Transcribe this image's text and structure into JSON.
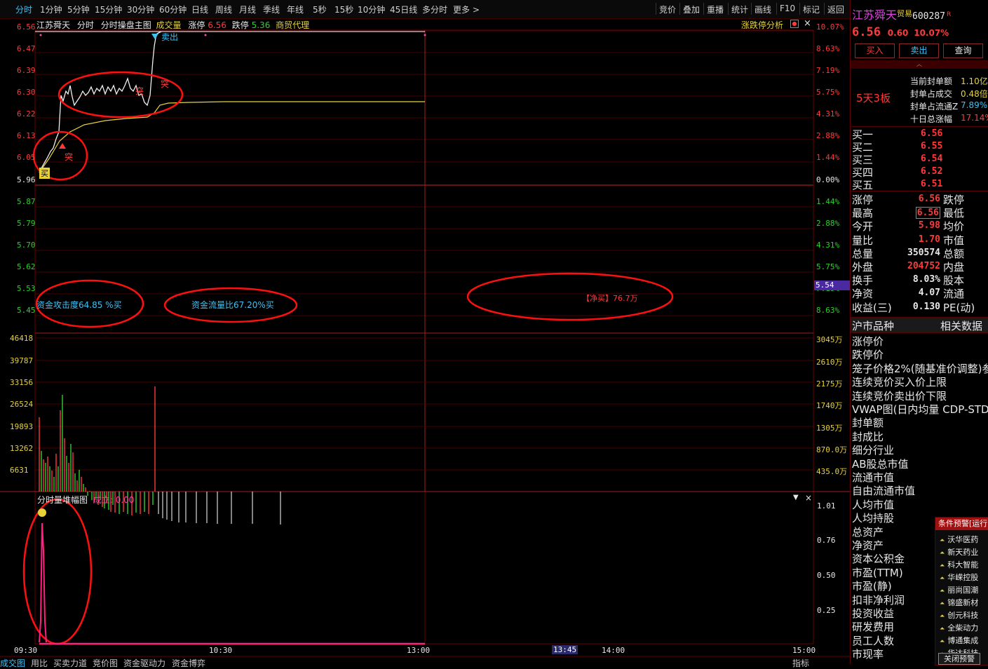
{
  "toolbar": {
    "periods": [
      "分时",
      "1分钟",
      "5分钟",
      "15分钟",
      "30分钟",
      "60分钟",
      "日线",
      "周线",
      "月线",
      "季线",
      "年线",
      "5秒",
      "15秒",
      "10分钟",
      "45日线",
      "多分时",
      "更多 >"
    ],
    "right": [
      "竞价",
      "叠加",
      "重播",
      "统计",
      "画线",
      "F10",
      "标记",
      "返回"
    ]
  },
  "header": {
    "name": "江苏舜天",
    "mode": "分时",
    "main_chart": "分时操盘主图",
    "volume_label": "成交量",
    "limit_up_label": "涨停",
    "limit_up_value": "6.56",
    "limit_down_label": "跌停",
    "limit_down_value": "5.36",
    "industry": "商贸代理",
    "analysis_btn": "涨跌停分析"
  },
  "price_axis": {
    "left": [
      "6.56",
      "6.47",
      "6.39",
      "6.30",
      "6.22",
      "6.13",
      "6.05",
      "5.96",
      "5.87",
      "5.79",
      "5.70",
      "5.62",
      "5.53",
      "5.45"
    ],
    "right": [
      "10.07%",
      "8.63%",
      "7.19%",
      "5.75%",
      "4.31%",
      "2.88%",
      "1.44%",
      "0.00%",
      "1.44%",
      "2.88%",
      "4.31%",
      "5.75%",
      "7.19%",
      "8.63%"
    ],
    "current_tag": "5.54"
  },
  "volume_axis": {
    "left": [
      "46418",
      "39787",
      "33156",
      "26524",
      "19893",
      "13262",
      "6631"
    ],
    "right": [
      "3045万",
      "2610万",
      "2175万",
      "1740万",
      "1305万",
      "870.0万",
      "435.0万"
    ]
  },
  "sub_chart": {
    "title": "分时量堆幅图",
    "stat_label": "成立: 0.00",
    "right_axis": [
      "1.01",
      "0.76",
      "0.50",
      "0.25"
    ]
  },
  "time_axis": [
    "09:30",
    "10:30",
    "13:00",
    "13:45",
    "14:00",
    "15:00"
  ],
  "annotations": {
    "attack": "资金攻击度64.85 %买",
    "flow": "资金流量比67.20%买",
    "net_buy": "【净买】76.7万",
    "sell_tag": "卖出",
    "buy_tag": "买",
    "tu": "突"
  },
  "quote": {
    "name": "江苏舜天",
    "tag": "贸易",
    "code": "600287",
    "flag": "R",
    "price": "6.56",
    "change": "0.60",
    "pct": "10.07%",
    "buttons": [
      "买入",
      "卖出",
      "查询"
    ],
    "board_text": "5天3板",
    "seal_rows": [
      {
        "label": "当前封单额",
        "value": "1.10亿"
      },
      {
        "label": "封单占成交",
        "value": "0.48倍"
      },
      {
        "label": "封单占流通Z",
        "value": "7.89%"
      },
      {
        "label": "十日总涨幅",
        "value": "17.14%"
      }
    ],
    "bids": [
      {
        "label": "买一",
        "value": "6.56"
      },
      {
        "label": "买二",
        "value": "6.55"
      },
      {
        "label": "买三",
        "value": "6.54"
      },
      {
        "label": "买四",
        "value": "6.52"
      },
      {
        "label": "买五",
        "value": "6.51"
      }
    ],
    "stats": [
      {
        "l1": "涨停",
        "v": "6.56",
        "l2": "跌停"
      },
      {
        "l1": "最高",
        "v": "6.56",
        "l2": "最低"
      },
      {
        "l1": "今开",
        "v": "5.98",
        "l2": "均价"
      },
      {
        "l1": "量比",
        "v": "1.70",
        "l2": "市值"
      },
      {
        "l1": "总量",
        "v": "350574",
        "l2": "总额"
      },
      {
        "l1": "外盘",
        "v": "204752",
        "l2": "内盘"
      },
      {
        "l1": "换手",
        "v": "8.03%",
        "l2": "股本"
      },
      {
        "l1": "净资",
        "v": "4.07",
        "l2": "流通"
      },
      {
        "l1": "收益(三)",
        "v": "0.130",
        "l2": "PE(动)"
      }
    ],
    "section_title": "沪市品种",
    "section_right": "相关数据",
    "info_rows": [
      "涨停价",
      "跌停价",
      "笼子价格2%(随基准价调整)参",
      "连续竞价买入价上限",
      "连续竞价卖出价下限",
      "VWAP图(日内均量 CDP-STD等",
      "封单额",
      "封成比",
      "细分行业",
      "AB股总市值",
      "流通市值",
      "自由流通市值",
      "人均市值",
      "人均持股",
      "总资产",
      "净资产",
      "资本公积金",
      "市盈(TTM)",
      "市盈(静)",
      "扣非净利润",
      "投资收益",
      "研发费用",
      "员工人数",
      "市现率"
    ]
  },
  "alerts": {
    "title": "条件预警[运行",
    "items": [
      "沃华医药",
      "新天药业",
      "科大智能",
      "华嵘控股",
      "丽尚国潮",
      "锦盛新材",
      "创元科技",
      "全柴动力",
      "博通集成",
      "华达科技"
    ],
    "close_btn": "关闭预警"
  },
  "bottom_tabs": [
    "成交图",
    "用比",
    "买卖力道",
    "竞价图",
    "资金驱动力",
    "资金博弈"
  ],
  "bottom_right": "指标"
}
